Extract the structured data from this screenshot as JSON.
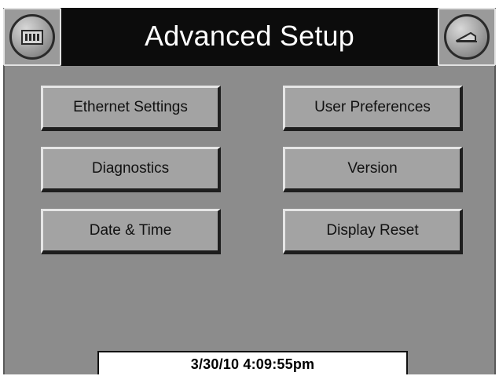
{
  "header": {
    "title": "Advanced Setup",
    "left_icon": "home-icon",
    "right_icon": "back-icon"
  },
  "menu": {
    "ethernet_settings": "Ethernet Settings",
    "user_preferences": "User Preferences",
    "diagnostics": "Diagnostics",
    "version": "Version",
    "date_time": "Date & Time",
    "display_reset": "Display Reset"
  },
  "status": {
    "datetime": "3/30/10  4:09:55pm"
  },
  "colors": {
    "title_bar": "#0c0c0c",
    "panel": "#8c8c8c",
    "button": "#a3a3a3"
  }
}
